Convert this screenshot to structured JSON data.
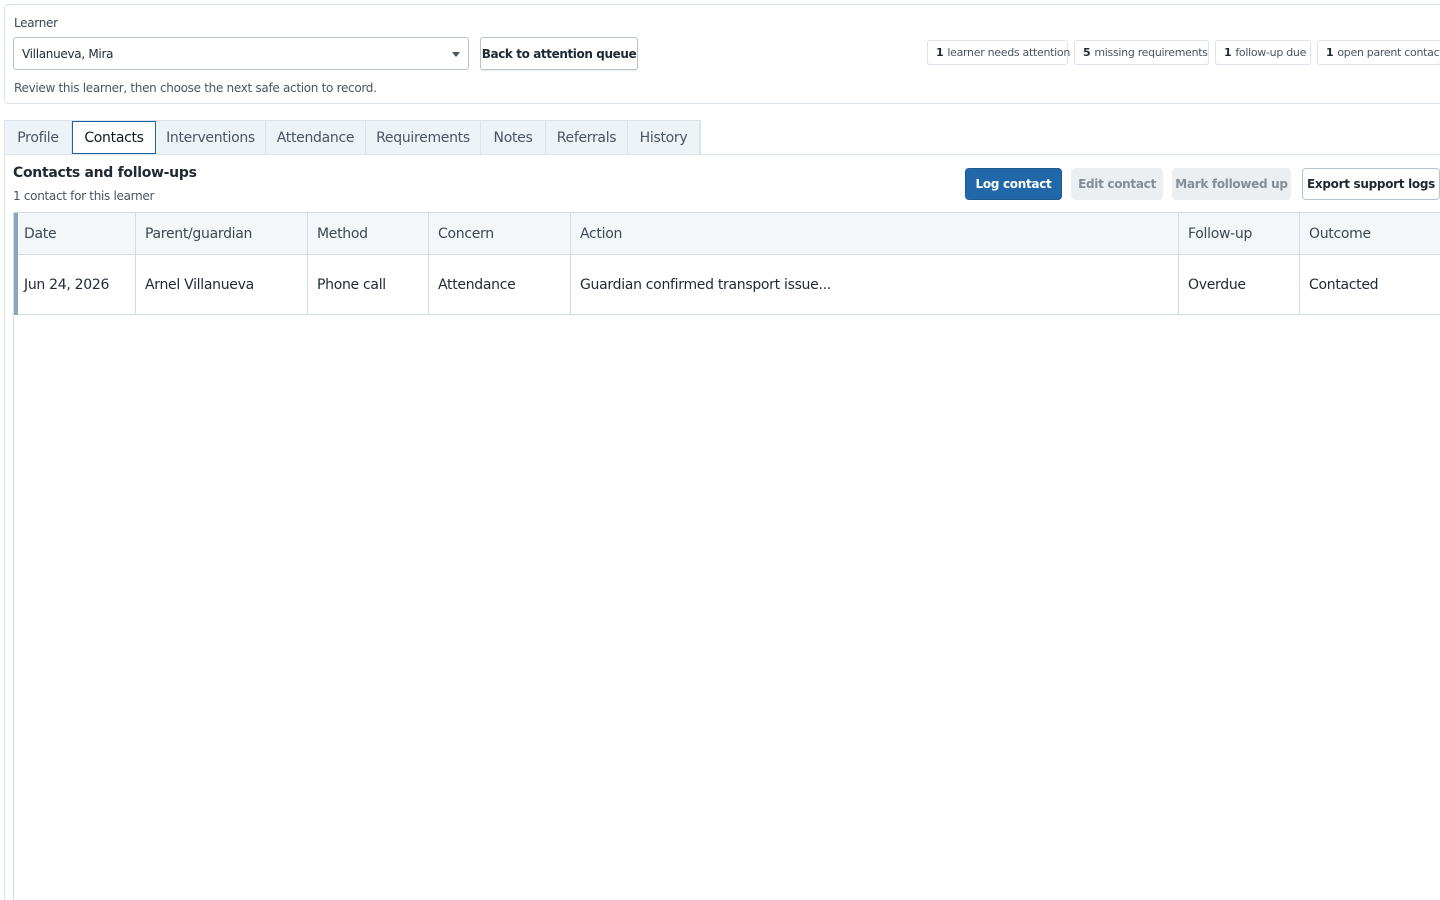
{
  "learner": {
    "label": "Learner",
    "selected": "Villanueva, Mira",
    "back_button": "Back to attention queue",
    "hint": "Review this learner, then choose the next safe action to record."
  },
  "badges": [
    {
      "count": "1",
      "text": "learner needs attention"
    },
    {
      "count": "5",
      "text": "missing requirements"
    },
    {
      "count": "1",
      "text": "follow-up due"
    },
    {
      "count": "1",
      "text": "open parent contact"
    }
  ],
  "tabs": [
    {
      "label": "Profile",
      "active": false
    },
    {
      "label": "Contacts",
      "active": true
    },
    {
      "label": "Interventions",
      "active": false
    },
    {
      "label": "Attendance",
      "active": false
    },
    {
      "label": "Requirements",
      "active": false
    },
    {
      "label": "Notes",
      "active": false
    },
    {
      "label": "Referrals",
      "active": false
    },
    {
      "label": "History",
      "active": false
    }
  ],
  "section": {
    "title": "Contacts and follow-ups",
    "subtitle": "1 contact for this learner"
  },
  "actions": {
    "log_contact": "Log contact",
    "edit_contact": "Edit contact",
    "mark_followed_up": "Mark followed up",
    "export": "Export support logs"
  },
  "table": {
    "columns": [
      "Date",
      "Parent/guardian",
      "Method",
      "Concern",
      "Action",
      "Follow-up",
      "Outcome"
    ],
    "rows": [
      [
        "Jun 24, 2026",
        "Arnel Villanueva",
        "Phone call",
        "Attendance",
        "Guardian confirmed transport issue...",
        "Overdue",
        "Contacted"
      ]
    ]
  },
  "colors": {
    "primary": "#2268a9",
    "active_tab_border": "#1f63a6",
    "row_accent": "#8aa4bd"
  }
}
